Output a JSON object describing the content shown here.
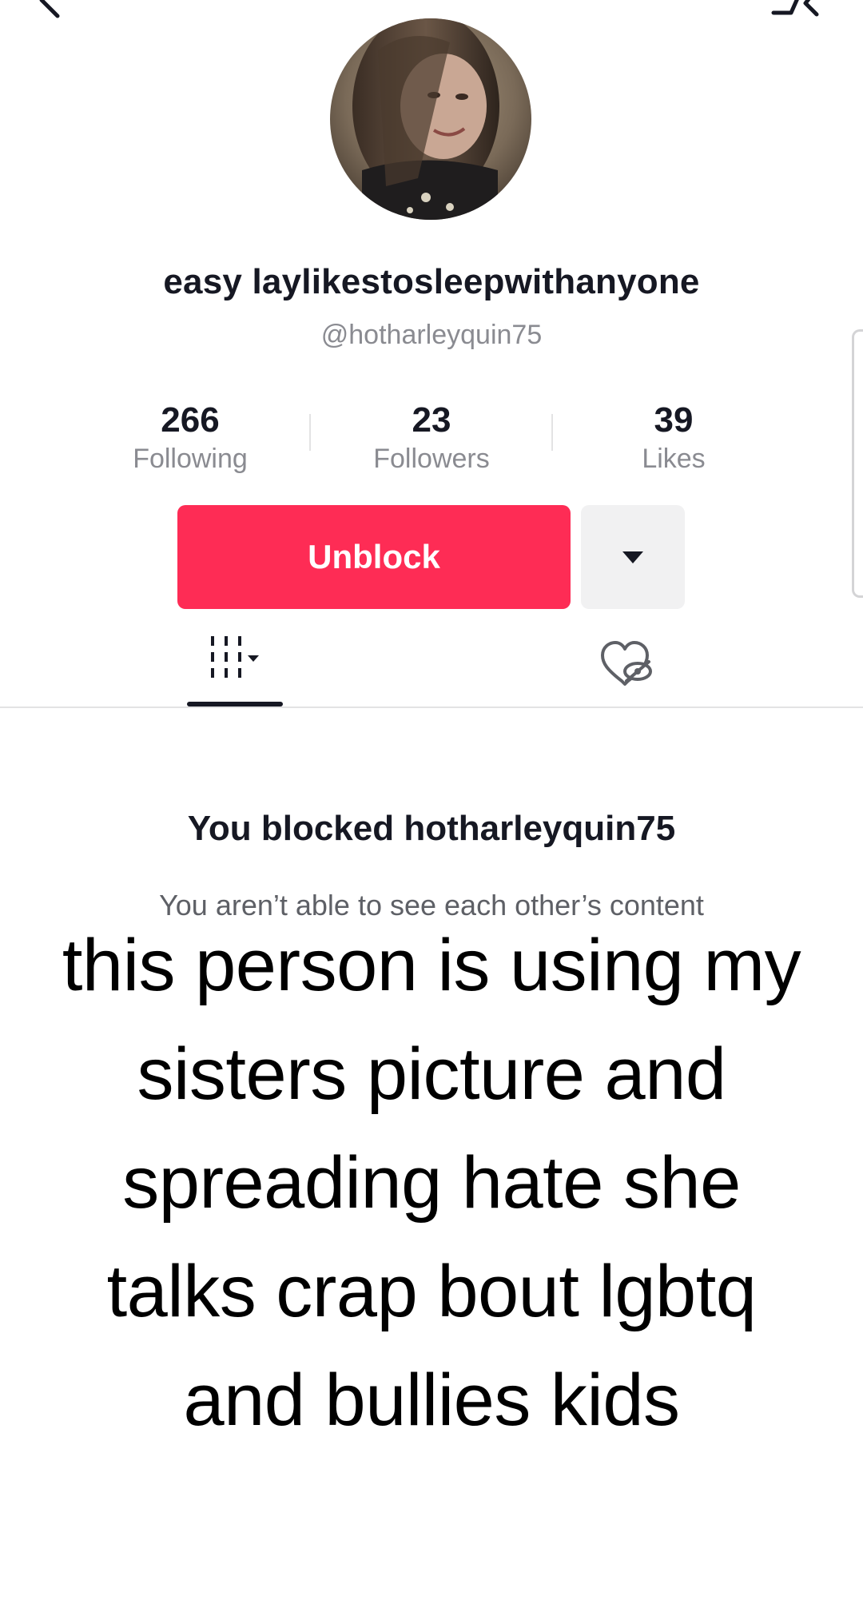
{
  "profile": {
    "display_name": "easy laylikestosleepwithanyone",
    "username": "@hotharleyquin75"
  },
  "stats": [
    {
      "value": "266",
      "label": "Following"
    },
    {
      "value": "23",
      "label": "Followers"
    },
    {
      "value": "39",
      "label": "Likes"
    }
  ],
  "actions": {
    "unblock_label": "Unblock",
    "more_icon": "caret-down-icon"
  },
  "tabs": [
    {
      "icon": "videos-grid-icon",
      "selected": true
    },
    {
      "icon": "liked-hidden-icon",
      "selected": false
    }
  ],
  "blocked": {
    "title": "You blocked hotharleyquin75",
    "subtitle": "You aren’t able to see each other’s content"
  },
  "caption": "this person is using my sisters picture and spreading hate she talks crap bout lgbtq and bullies kids",
  "colors": {
    "accent": "#fe2c55",
    "text_primary": "#161823",
    "text_secondary": "#8a8b91",
    "secondary_button": "#f1f1f2"
  }
}
